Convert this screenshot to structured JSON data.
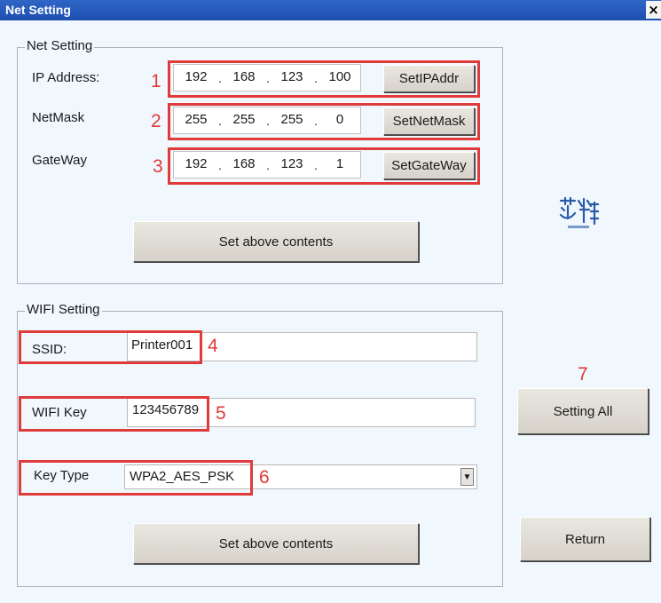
{
  "window": {
    "title": "Net Setting",
    "close_glyph": "×"
  },
  "net_group": {
    "legend": "Net Setting",
    "ip": {
      "label": "IP Address:",
      "octets": [
        "192",
        "168",
        "123",
        "100"
      ],
      "button": "SetIPAddr",
      "marker": "1"
    },
    "netmask": {
      "label": "NetMask",
      "octets": [
        "255",
        "255",
        "255",
        "0"
      ],
      "button": "SetNetMask",
      "marker": "2"
    },
    "gateway": {
      "label": "GateWay",
      "octets": [
        "192",
        "168",
        "123",
        "1"
      ],
      "button": "SetGateWay",
      "marker": "3"
    },
    "apply_button": "Set above contents"
  },
  "wifi_group": {
    "legend": "WIFI Setting",
    "ssid": {
      "label": "SSID:",
      "value": "Printer001",
      "marker": "4"
    },
    "key": {
      "label": "WIFI Key",
      "value": "123456789",
      "marker": "5"
    },
    "key_type": {
      "label": "Key Type",
      "value": "WPA2_AES_PSK",
      "marker": "6",
      "dropdown_icon": "▼"
    },
    "apply_button": "Set above contents"
  },
  "side": {
    "setting_all_marker": "7",
    "setting_all_button": "Setting All",
    "return_button": "Return"
  },
  "colors": {
    "accent_red": "#e03a3a",
    "title_bar": "#1d4fb0",
    "logo_blue": "#2a5aa8"
  },
  "icons": {
    "logo": "brand-logo-icon"
  }
}
